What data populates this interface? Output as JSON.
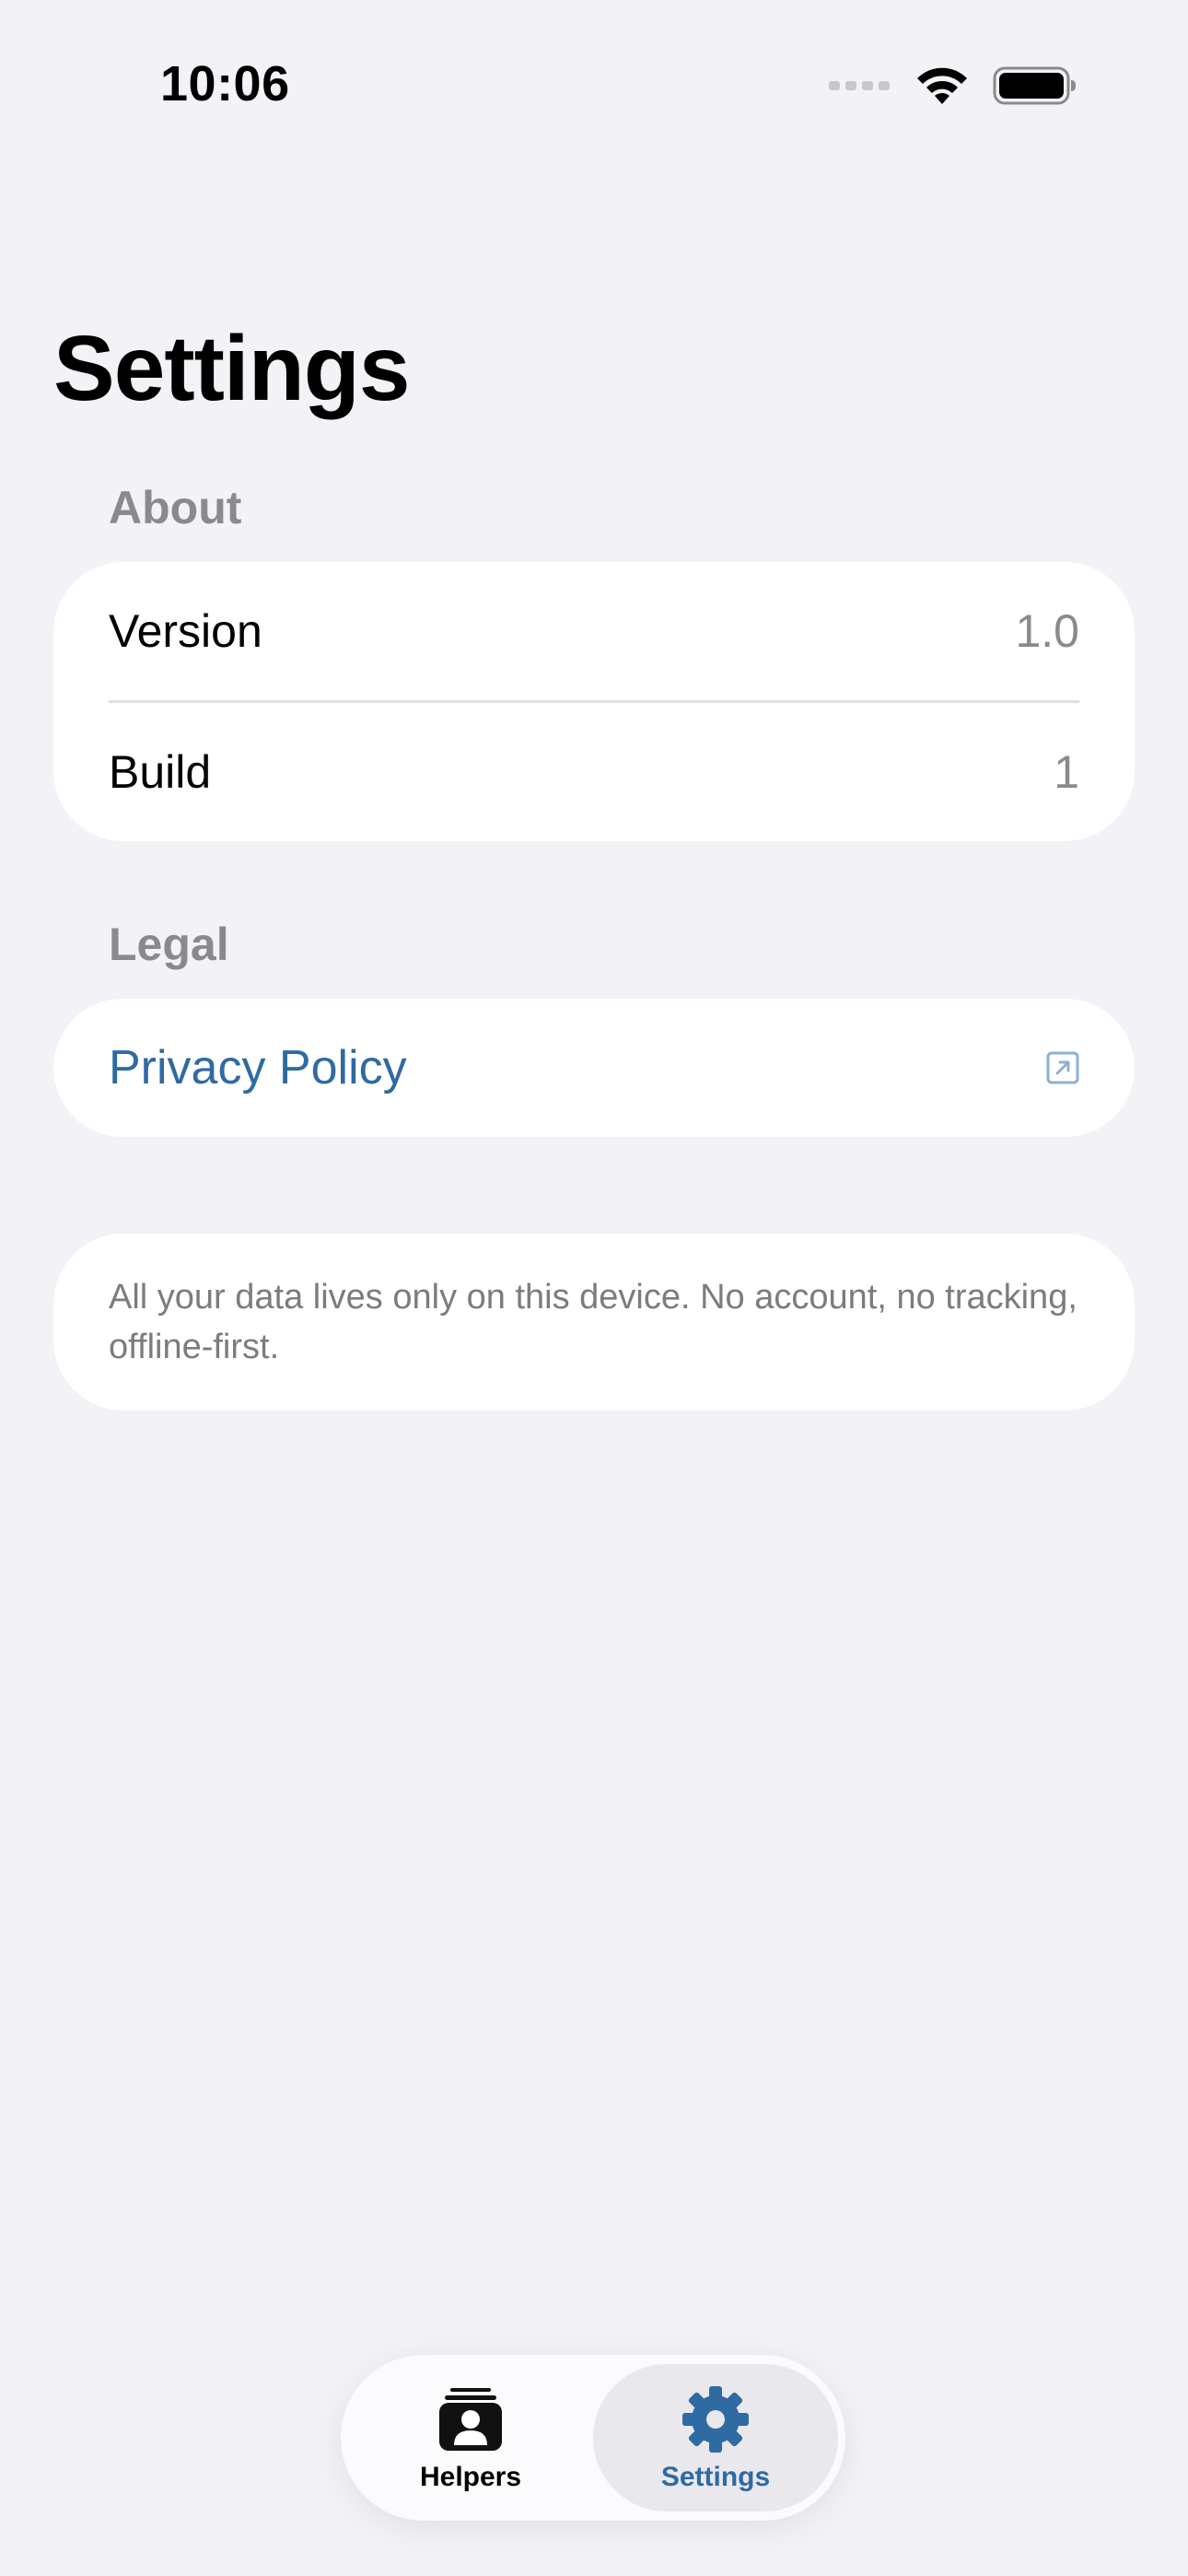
{
  "status_bar": {
    "time": "10:06"
  },
  "page": {
    "title": "Settings"
  },
  "sections": {
    "about": {
      "header": "About",
      "rows": [
        {
          "label": "Version",
          "value": "1.0"
        },
        {
          "label": "Build",
          "value": "1"
        }
      ]
    },
    "legal": {
      "header": "Legal",
      "privacy_label": "Privacy Policy",
      "privacy_icon": "external-link-icon"
    },
    "note": {
      "text": "All your data lives only on this device. No account, no tracking, offline-first."
    }
  },
  "tab_bar": {
    "tabs": [
      {
        "label": "Helpers",
        "icon": "contacts-icon",
        "active": false
      },
      {
        "label": "Settings",
        "icon": "gear-icon",
        "active": true
      }
    ]
  },
  "colors": {
    "background": "#f2f2f7",
    "accent": "#2f6aa3",
    "secondary_text": "#8a8a8e",
    "card": "#ffffff"
  }
}
